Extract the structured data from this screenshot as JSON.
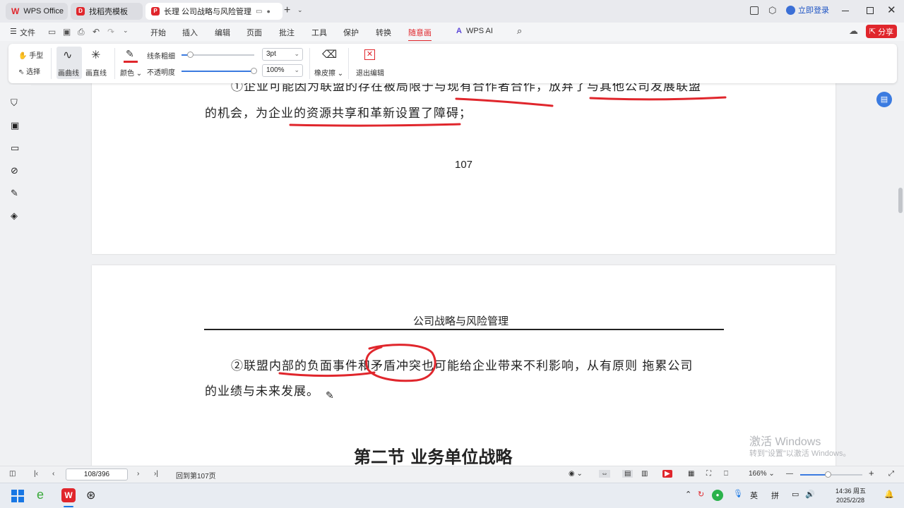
{
  "tabs": [
    {
      "label": "WPS Office"
    },
    {
      "label": "找稻壳模板"
    },
    {
      "label": "长理    公司战略与风险管理教"
    }
  ],
  "titlebar": {
    "login_label": "立即登录"
  },
  "menu": {
    "file": "文件",
    "items": [
      "开始",
      "插入",
      "编辑",
      "页面",
      "批注",
      "工具",
      "保护",
      "转换",
      "随意画"
    ],
    "ai": "WPS AI",
    "share": "分享"
  },
  "ribbon": {
    "hand": "手型",
    "select": "选择",
    "curve": "画曲线",
    "line": "画直线",
    "color": "颜色",
    "stroke_label": "线条粗细",
    "stroke_value": "3pt",
    "stroke_level": 0.13,
    "opacity_label": "不透明度",
    "opacity_value": "100%",
    "opacity_level": 1.0,
    "eraser": "橡皮擦",
    "exit": "退出编辑",
    "accent_color": "#e0262c"
  },
  "document": {
    "page1_line1": "①企业可能因为联盟的存在被局限于与现有合作者合作，放弃了与其他公司发展联盟",
    "page1_line2": "的机会，为企业的资源共享和革新设置了障碍；",
    "page_number": "107",
    "header_title": "公司战略与风险管理",
    "page2_line1": "②联盟内部的负面事件和矛盾冲突也可能给企业带来不利影响，从有原则 拖累公司",
    "page2_line2": "的业绩与未来发展。",
    "section_title": "第二节  业务单位战略",
    "watermark_title": "激活 Windows",
    "watermark_sub": "转到\"设置\"以激活 Windows。"
  },
  "status": {
    "page_field": "108/396",
    "back_to": "回到第107页",
    "zoom": "166%",
    "zoom_level": 0.45
  },
  "taskbar": {
    "ime1": "英",
    "ime2": "拼",
    "time": "14:36 周五",
    "date": "2025/2/28"
  }
}
